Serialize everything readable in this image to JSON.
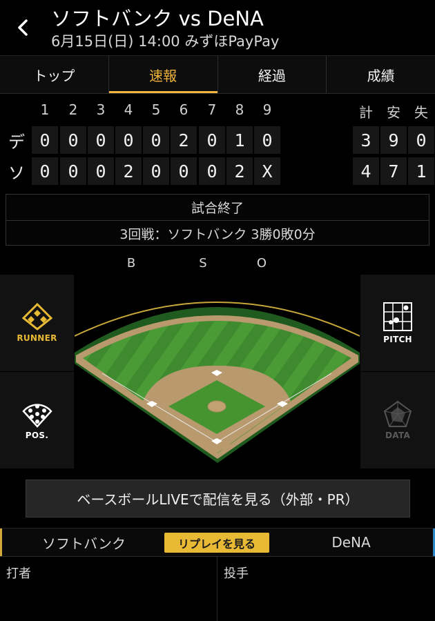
{
  "header": {
    "title": "ソフトバンク vs DeNA",
    "subtitle": "6月15日(日) 14:00 みずほPayPay"
  },
  "tabs": [
    {
      "label": "トップ",
      "active": false
    },
    {
      "label": "速報",
      "active": true
    },
    {
      "label": "経過",
      "active": false
    },
    {
      "label": "成績",
      "active": false
    }
  ],
  "scoreboard": {
    "innings": [
      "1",
      "2",
      "3",
      "4",
      "5",
      "6",
      "7",
      "8",
      "9"
    ],
    "totals_headers": [
      "計",
      "安",
      "失"
    ],
    "rows": [
      {
        "team": "デ",
        "scores": [
          "0",
          "0",
          "0",
          "0",
          "0",
          "2",
          "0",
          "1",
          "0"
        ],
        "totals": [
          "3",
          "9",
          "0"
        ]
      },
      {
        "team": "ソ",
        "scores": [
          "0",
          "0",
          "0",
          "2",
          "0",
          "0",
          "0",
          "2",
          "X"
        ],
        "totals": [
          "4",
          "7",
          "1"
        ]
      }
    ]
  },
  "status": {
    "game_state": "試合終了",
    "series": "3回戦：ソフトバンク 3勝0敗0分"
  },
  "bso": {
    "b": "B",
    "s": "S",
    "o": "O"
  },
  "side_buttons": {
    "runner": "RUNNER",
    "pitch": "PITCH",
    "pos": "POS.",
    "data": "DATA"
  },
  "live_button": "ベースボールLIVEで配信を見る（外部・PR）",
  "team_bar": {
    "home": "ソフトバンク",
    "replay": "リプレイを見る",
    "away": "DeNA"
  },
  "bottom": {
    "batter": "打者",
    "pitcher": "投手"
  },
  "colors": {
    "accent": "#f0b43a",
    "home_team": "#d4a73a",
    "away_team": "#2e86c8",
    "grass": "#3f8a2e",
    "dirt": "#b99a6e"
  }
}
